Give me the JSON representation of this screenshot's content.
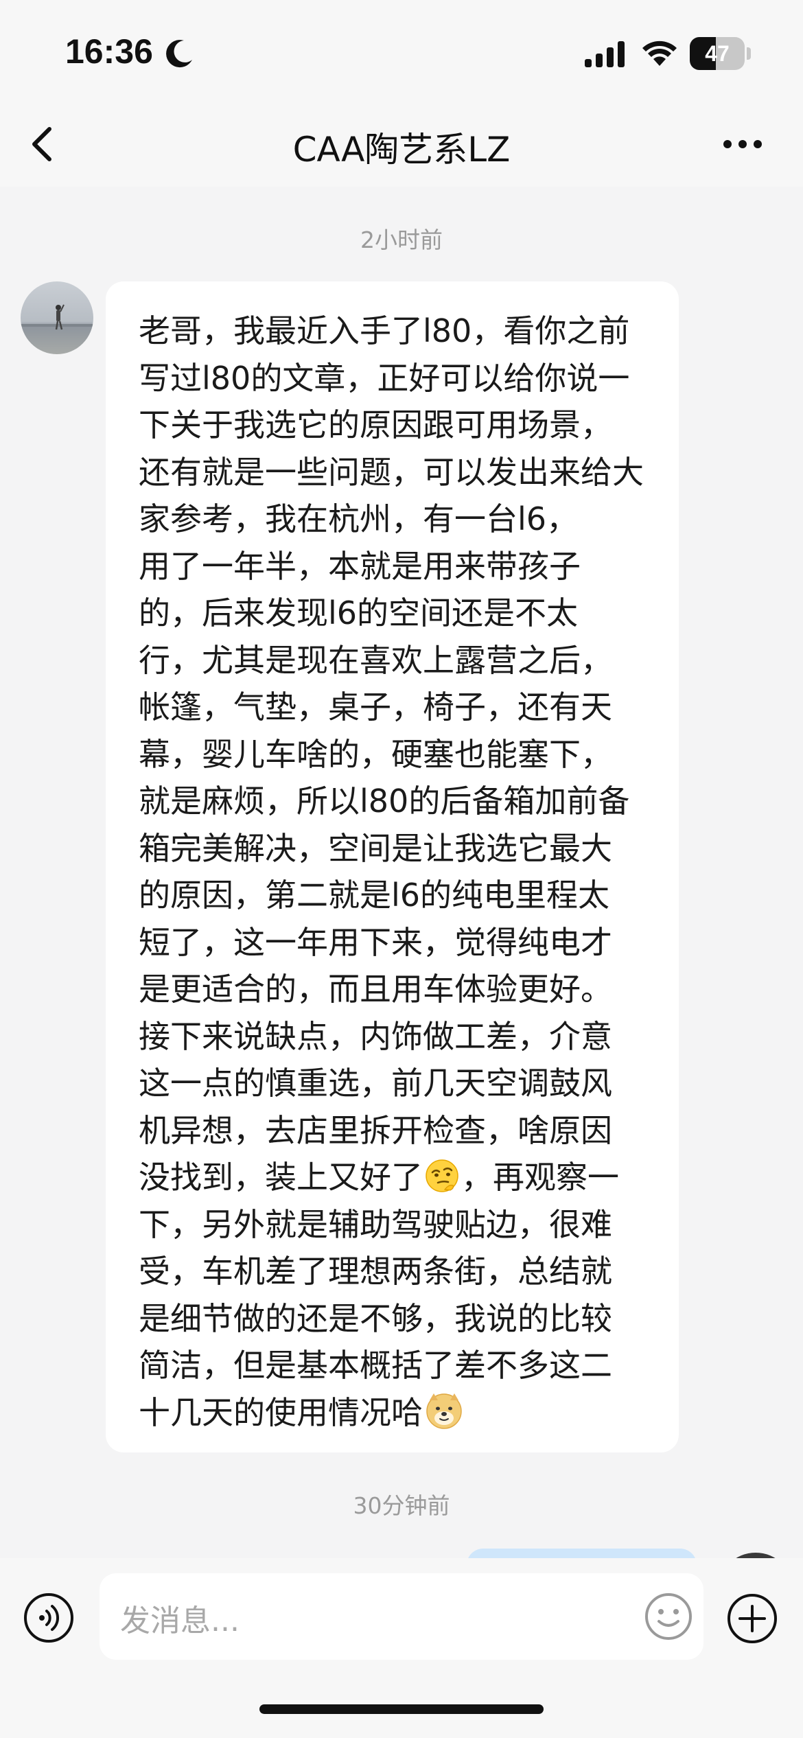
{
  "status_bar": {
    "time": "16:36",
    "battery_level": "47",
    "battery_fraction": 0.47,
    "icons": [
      "moon-icon",
      "cellular-signal-icon",
      "wifi-icon",
      "battery-icon"
    ]
  },
  "nav": {
    "title": "CAA陶艺系LZ",
    "back_icon": "chevron-left-icon",
    "more_icon": "more-horizontal-icon"
  },
  "chat": {
    "timestamps": [
      "2小时前",
      "30分钟前"
    ],
    "incoming_message": {
      "text_part1": "老哥，我最近入手了l80，看你之前写过l80的文章，正好可以给你说一下关于我选它的原因跟可用场景，\n还有就是一些问题，可以发出来给大家参考，我在杭州，有一台l6，\n用了一年半，本就是用来带孩子\n的，后来发现l6的空间还是不太\n行，尤其是现在喜欢上露营之后，\n帐篷，气垫，桌子，椅子，还有天\n幕，婴儿车啥的，硬塞也能塞下，\n就是麻烦，所以l80的后备箱加前备箱完美解决，空间是让我选它最大\n的原因，第二就是l6的纯电里程太\n短了，这一年用下来，觉得纯电才\n是更适合的，而且用车体验更好。\n接下来说缺点，内饰做工差，介意\n这一点的慎重选，前几天空调鼓风\n机异想，去店里拆开检查，啥原因\n没找到，装上又好了",
      "text_part2": "，再观察一\n下，另外就是辅助驾驶贴边，很难\n受，车机差了理想两条街，总结就\n是细节做的还是不够，我说的比较\n简洁，但是基本概括了差不多这二\n十几天的使用情况哈",
      "emojis": [
        "thinking-face-emoji",
        "doge-emoji"
      ]
    }
  },
  "input_bar": {
    "placeholder": "发消息...",
    "icons": [
      "voice-icon",
      "emoji-icon",
      "plus-icon"
    ]
  },
  "colors": {
    "background": "#f4f4f5",
    "bubble": "#ffffff",
    "outgoing_bubble": "#cfe6fb",
    "timestamp": "#9a9a9a"
  }
}
